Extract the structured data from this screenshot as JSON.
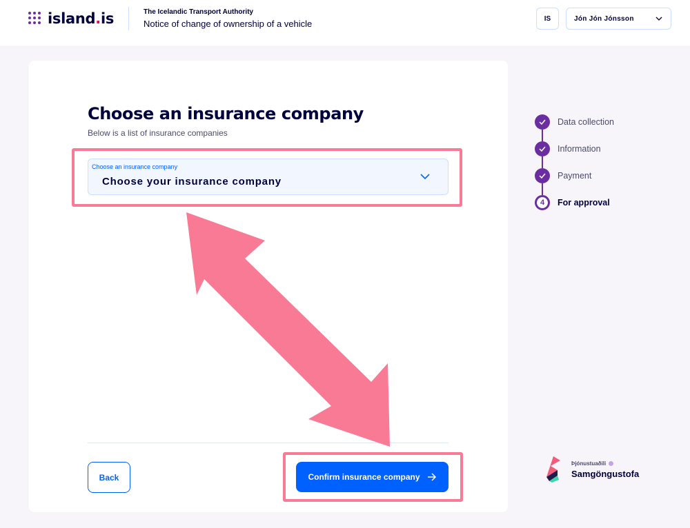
{
  "header": {
    "logo_text": "island",
    "logo_dot": ".",
    "logo_tld": "is",
    "org_name": "The Icelandic Transport Authority",
    "app_title": "Notice of change of ownership of a vehicle",
    "language_button": "IS",
    "user_name": "Jón Jón Jónsson"
  },
  "form": {
    "title": "Choose an insurance company",
    "subtitle": "Below is a list of insurance companies",
    "select": {
      "label": "Choose an insurance company",
      "value": "Choose your insurance company"
    },
    "back_label": "Back",
    "confirm_label": "Confirm insurance company"
  },
  "steps": [
    {
      "label": "Data collection",
      "state": "completed"
    },
    {
      "label": "Information",
      "state": "completed"
    },
    {
      "label": "Payment",
      "state": "completed"
    },
    {
      "label": "For approval",
      "state": "current",
      "number": "4"
    }
  ],
  "provider": {
    "label": "Þjónustuaðili",
    "name": "Samgöngustofa"
  },
  "colors": {
    "primary": "#0061ff",
    "purple": "#6a2ea0",
    "highlight": "#f97a94",
    "background": "#f8f5fa"
  }
}
